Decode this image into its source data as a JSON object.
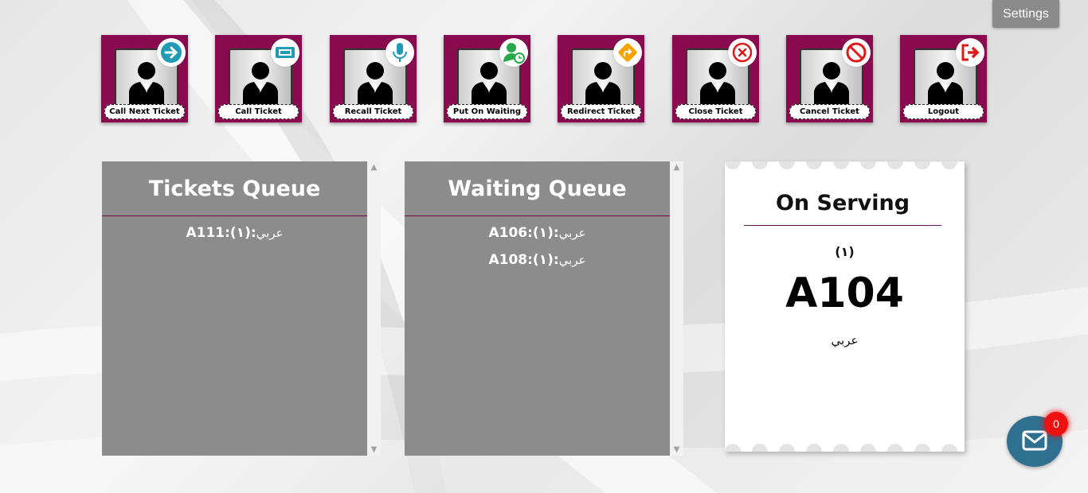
{
  "header": {
    "settings_label": "Settings"
  },
  "actions": [
    {
      "label": "Call Next Ticket",
      "icon": "arrow-right-icon",
      "color": "#1f9bb3"
    },
    {
      "label": "Call Ticket",
      "icon": "ticket-icon",
      "color": "#1f9bb3"
    },
    {
      "label": "Recall Ticket",
      "icon": "microphone-icon",
      "color": "#1f9bb3"
    },
    {
      "label": "Put On Waiting",
      "icon": "user-clock-icon",
      "color": "#27a84a"
    },
    {
      "label": "Redirect Ticket",
      "icon": "redirect-icon",
      "color": "#f5a300"
    },
    {
      "label": "Close Ticket",
      "icon": "close-circle-icon",
      "color": "#e01919"
    },
    {
      "label": "Cancel Ticket",
      "icon": "ban-icon",
      "color": "#e01919"
    },
    {
      "label": "Logout",
      "icon": "logout-icon",
      "color": "#e01919"
    }
  ],
  "tickets_queue": {
    "title": "Tickets Queue",
    "items": [
      {
        "ticket": "A111:(",
        "counter": "١",
        "sep": "):",
        "service": "عربي"
      }
    ]
  },
  "waiting_queue": {
    "title": "Waiting Queue",
    "items": [
      {
        "ticket": "A106:(",
        "counter": "١",
        "sep": "):",
        "service": "عربي"
      },
      {
        "ticket": "A108:(",
        "counter": "١",
        "sep": "):",
        "service": "عربي"
      }
    ]
  },
  "on_serving": {
    "title": "On Serving",
    "counter": "(١)",
    "ticket": "A104",
    "service": "عربي"
  },
  "messages": {
    "unread_count": "0"
  },
  "colors": {
    "accent": "#8a0a50",
    "panel": "#8c8c8c",
    "mail": "#2f6f8f",
    "badge": "#ee1010"
  }
}
